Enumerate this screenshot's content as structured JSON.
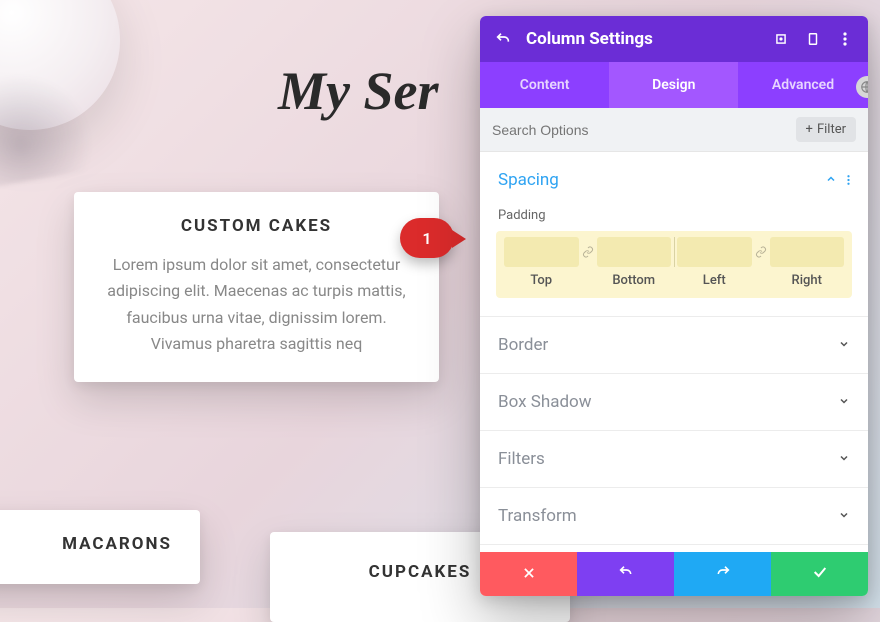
{
  "page": {
    "heading": "My Ser",
    "annotation_number": "1"
  },
  "cards": {
    "main": {
      "title": "CUSTOM CAKES",
      "body": "Lorem ipsum dolor sit amet, consectetur adipiscing elit. Maecenas ac turpis mattis, faucibus urna vitae, dignissim lorem. Vivamus pharetra sagittis neq"
    },
    "left": {
      "title": "MACARONS"
    },
    "right": {
      "title": "CUPCAKES"
    }
  },
  "panel": {
    "title": "Column Settings",
    "tabs": {
      "content": "Content",
      "design": "Design",
      "advanced": "Advanced"
    },
    "search_placeholder": "Search Options",
    "filter_label": "Filter",
    "sections": {
      "spacing": "Spacing",
      "border": "Border",
      "box_shadow": "Box Shadow",
      "filters": "Filters",
      "transform": "Transform"
    },
    "padding": {
      "heading": "Padding",
      "top": "Top",
      "bottom": "Bottom",
      "left": "Left",
      "right": "Right"
    }
  }
}
